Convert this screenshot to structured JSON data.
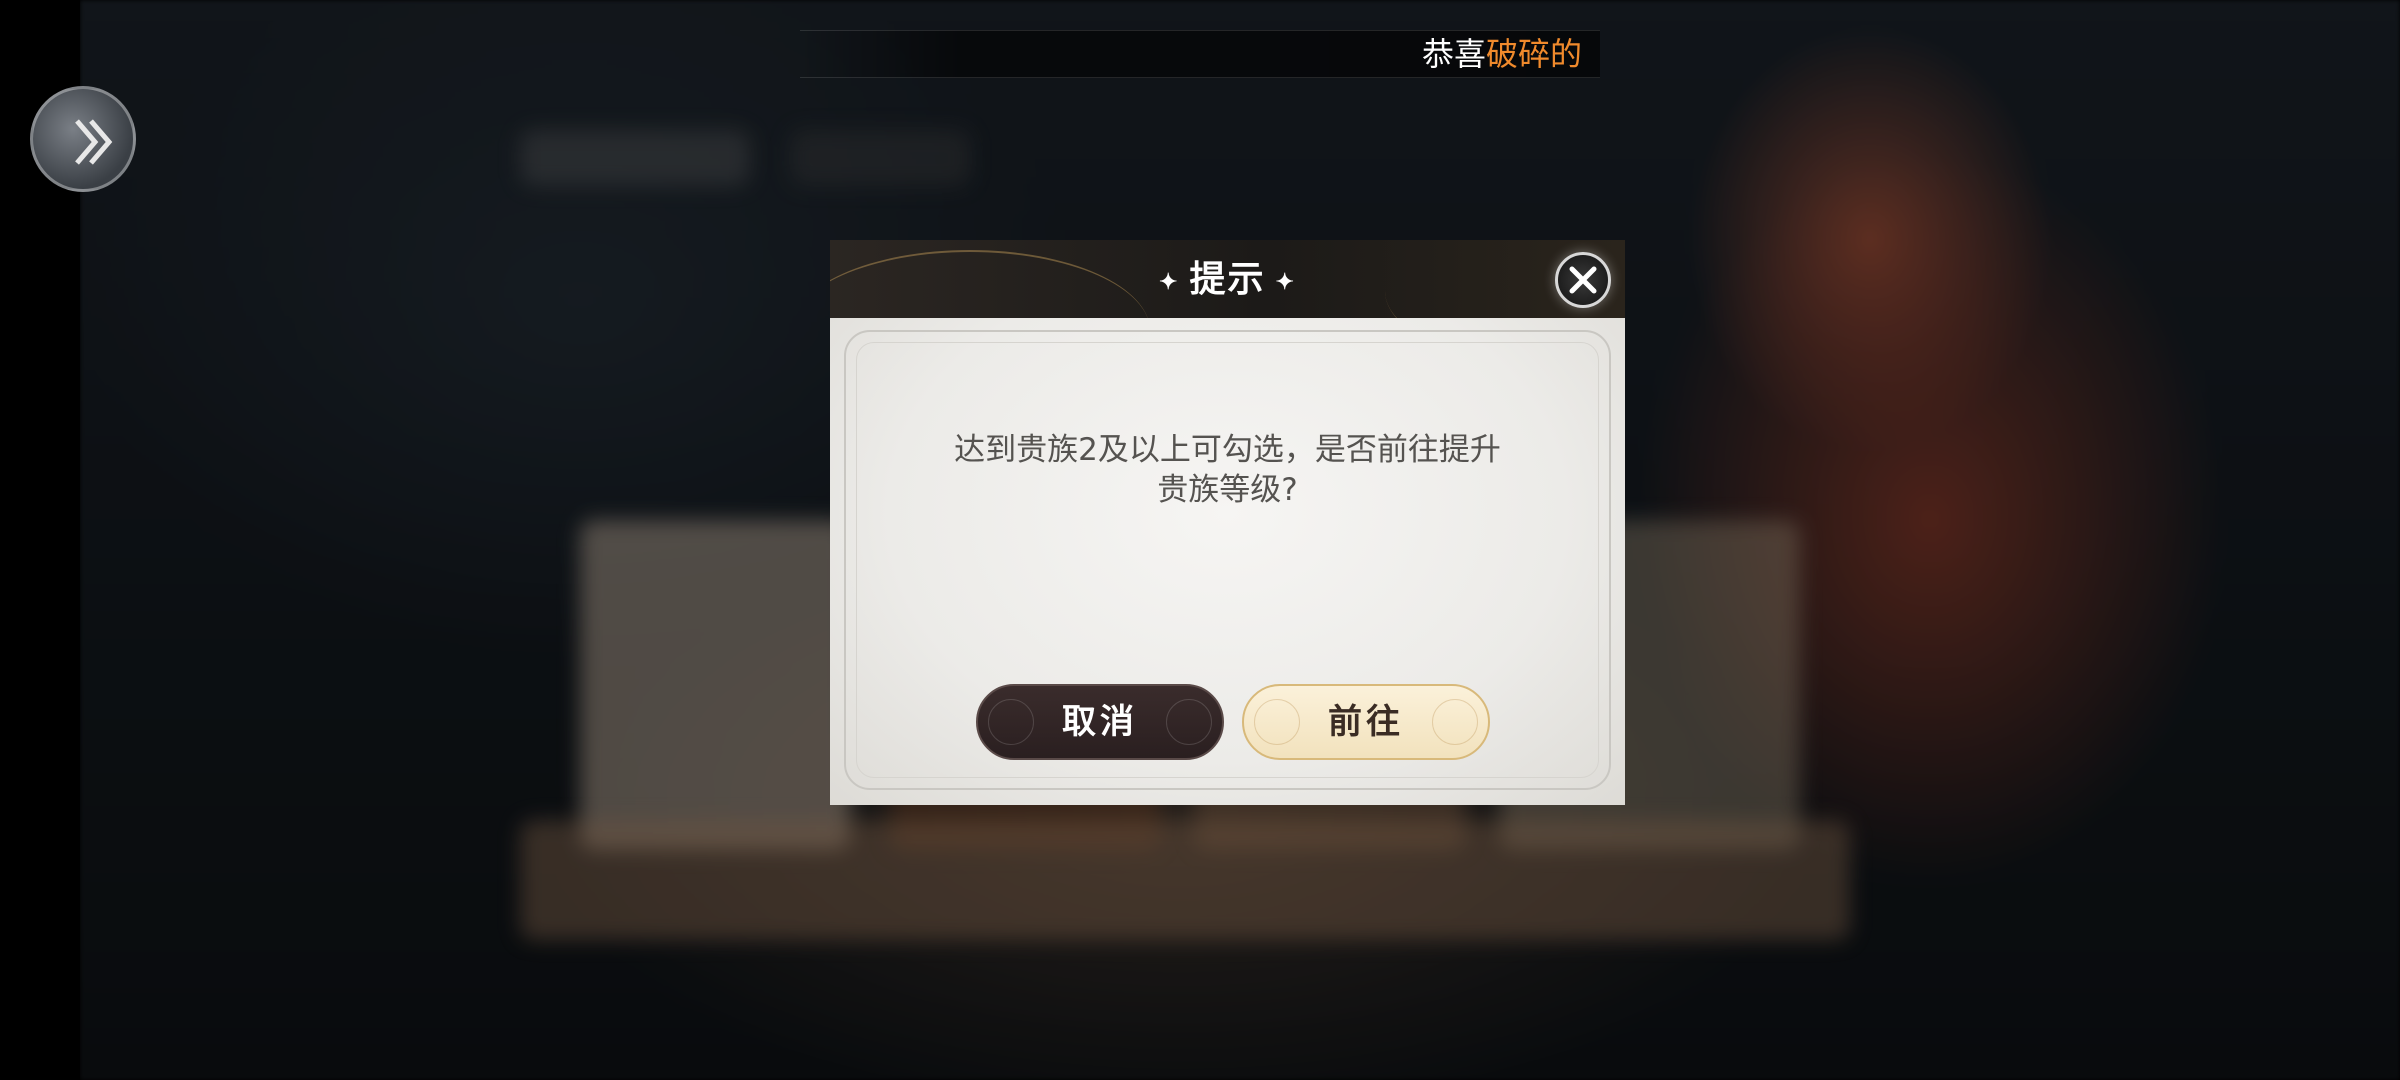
{
  "marquee": {
    "prefix": "恭喜",
    "highlight": "破碎的"
  },
  "dialog": {
    "title": "提示",
    "title_decoration": "✦",
    "message_line1": "达到贵族2及以上可勾选，是否前往提升",
    "message_line2": "贵族等级?",
    "cancel_label": "取消",
    "confirm_label": "前往"
  },
  "colors": {
    "highlight": "#f08a2c",
    "cancel_button": "#2a1f20",
    "confirm_button": "#f2e2bd"
  },
  "icons": {
    "side_button": "chevron-double-right-icon",
    "close": "close-icon"
  }
}
